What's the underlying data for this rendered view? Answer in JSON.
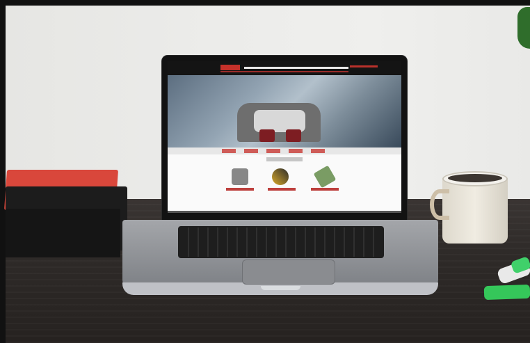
{
  "scene": {
    "description_label": "",
    "colors": {
      "wall": "#ececea",
      "desk": "#2e2a28",
      "book_red": "#d9473b",
      "laptop_screen_bg": "#121212",
      "mug": "#f0ece2",
      "highlighter": "#35c75a"
    },
    "laptop_screen": {
      "brand_color": "#c5312a"
    }
  }
}
